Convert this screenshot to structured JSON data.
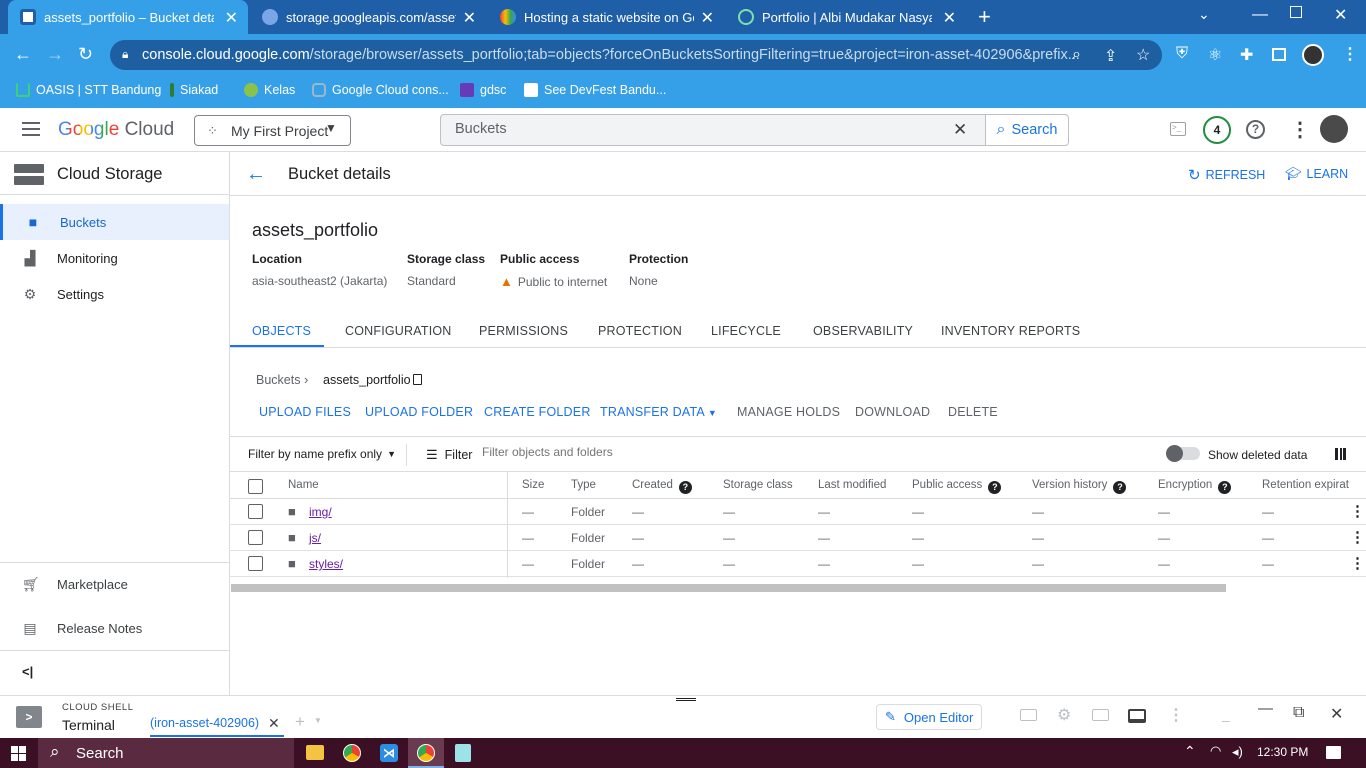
{
  "browser": {
    "tabs": [
      {
        "title": "assets_portfolio – Bucket details",
        "active": true
      },
      {
        "title": "storage.googleapis.com/assets_p",
        "active": false
      },
      {
        "title": "Hosting a static website on Goo",
        "active": false
      },
      {
        "title": "Portfolio | Albi Mudakar Nasyabi",
        "active": false
      }
    ],
    "url_host": "console.cloud.google.com",
    "url_path": "/storage/browser/assets_portfolio;tab=objects?forceOnBucketsSortingFiltering=true&project=iron-asset-402906&prefix...",
    "bookmarks": [
      "OASIS | STT Bandung",
      "Siakad",
      "Kelas",
      "Google Cloud cons...",
      "gdsc",
      "See DevFest Bandu..."
    ]
  },
  "header": {
    "logo_google": "Google",
    "logo_cloud": "Cloud",
    "project": "My First Project",
    "search_value": "Buckets",
    "search_button": "Search",
    "notifications_count": "4"
  },
  "sidebar": {
    "title": "Cloud Storage",
    "items": [
      {
        "label": "Buckets",
        "icon": "bucket-icon",
        "selected": true
      },
      {
        "label": "Monitoring",
        "icon": "chart-icon",
        "selected": false
      },
      {
        "label": "Settings",
        "icon": "gear-icon",
        "selected": false
      }
    ],
    "bottom_items": [
      "Marketplace",
      "Release Notes"
    ],
    "collapse_label": "<|"
  },
  "page": {
    "title": "Bucket details",
    "refresh": "REFRESH",
    "learn": "LEARN",
    "bucket_name": "assets_portfolio",
    "meta": [
      {
        "label": "Location",
        "value": "asia-southeast2 (Jakarta)"
      },
      {
        "label": "Storage class",
        "value": "Standard"
      },
      {
        "label": "Public access",
        "value": "Public to internet"
      },
      {
        "label": "Protection",
        "value": "None"
      }
    ],
    "tabs": [
      "OBJECTS",
      "CONFIGURATION",
      "PERMISSIONS",
      "PROTECTION",
      "LIFECYCLE",
      "OBSERVABILITY",
      "INVENTORY REPORTS"
    ],
    "breadcrumb": [
      "Buckets",
      "assets_portfolio"
    ],
    "actions": [
      "UPLOAD FILES",
      "UPLOAD FOLDER",
      "CREATE FOLDER",
      "TRANSFER DATA",
      "MANAGE HOLDS",
      "DOWNLOAD",
      "DELETE"
    ],
    "filter_mode": "Filter by name prefix only",
    "filter_label": "Filter",
    "filter_placeholder": "Filter objects and folders",
    "show_deleted": "Show deleted data",
    "columns": [
      "Name",
      "Size",
      "Type",
      "Created",
      "Storage class",
      "Last modified",
      "Public access",
      "Version history",
      "Encryption",
      "Retention expirat"
    ],
    "rows": [
      {
        "name": "img/",
        "size": "—",
        "type": "Folder",
        "created": "—",
        "storage": "—",
        "modified": "—",
        "public": "—",
        "version": "—",
        "encryption": "—",
        "retention": "—"
      },
      {
        "name": "js/",
        "size": "—",
        "type": "Folder",
        "created": "—",
        "storage": "—",
        "modified": "—",
        "public": "—",
        "version": "—",
        "encryption": "—",
        "retention": "—"
      },
      {
        "name": "styles/",
        "size": "—",
        "type": "Folder",
        "created": "—",
        "storage": "—",
        "modified": "—",
        "public": "—",
        "version": "—",
        "encryption": "—",
        "retention": "—"
      }
    ]
  },
  "shell": {
    "label_top": "CLOUD SHELL",
    "label": "Terminal",
    "tab": "(iron-asset-402906)",
    "open_editor": "Open Editor"
  },
  "taskbar": {
    "search": "Search",
    "time": "12:30 PM"
  },
  "colors": {
    "accent": "#1a73e8",
    "chrome": "#35a0e8",
    "warning": "#e37400"
  }
}
